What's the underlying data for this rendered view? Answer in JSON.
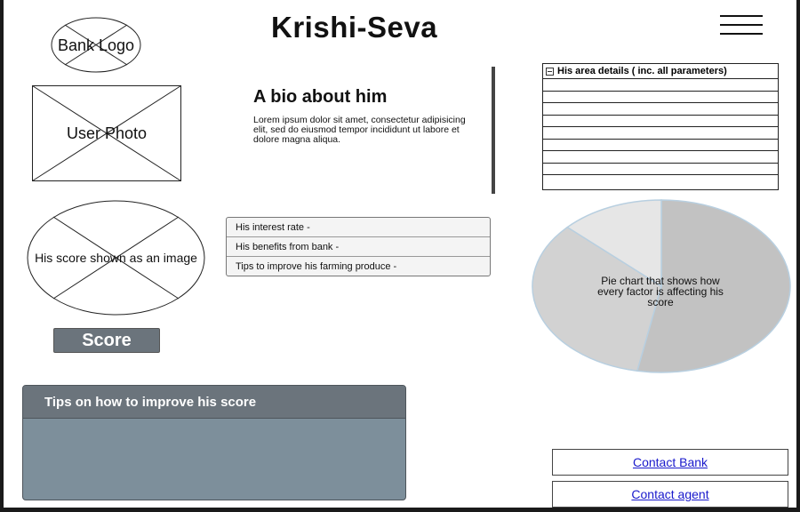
{
  "header": {
    "title": "Krishi-Seva",
    "menu_icon": "hamburger-icon"
  },
  "placeholders": {
    "bank_logo": "Bank Logo",
    "user_photo": "User Photo",
    "score_image": "His score shown as an image"
  },
  "bio": {
    "heading": "A bio about him",
    "text": "Lorem ipsum dolor sit amet, consectetur adipisicing elit, sed do eiusmod tempor incididunt ut labore et dolore magna aliqua."
  },
  "area_details": {
    "header": "His area details ( inc. all parameters)",
    "header_icon": "collapse-icon",
    "rows": [
      "",
      "",
      "",
      "",
      "",
      "",
      "",
      "",
      ""
    ]
  },
  "info_items": [
    {
      "label": "His interest rate -"
    },
    {
      "label": "His benefits from bank -"
    },
    {
      "label": "Tips to improve his farming produce -"
    }
  ],
  "score_button": "Score",
  "pie_chart": {
    "label": "Pie chart that shows how every factor is affecting his score",
    "slice_fractions": [
      0.53,
      0.34,
      0.13
    ],
    "colors": [
      "#c2c2c2",
      "#d2d2d2",
      "#e6e6e6"
    ],
    "stroke_color": "#b8cfe0"
  },
  "tips_panel": {
    "title": "Tips on how to improve his score"
  },
  "contacts": {
    "bank": "Contact Bank",
    "agent": "Contact agent"
  }
}
